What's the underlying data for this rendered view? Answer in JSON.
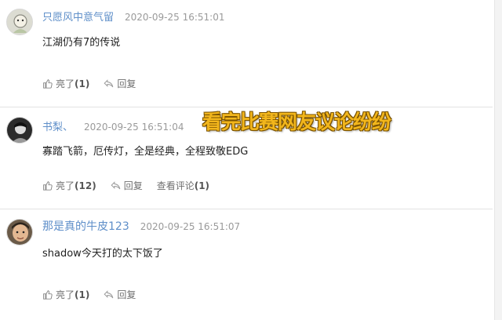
{
  "overlay_caption": "看完比赛网友议论纷纷",
  "comments": [
    {
      "username": "只愿风中意气留",
      "timestamp": "2020-09-25 16:51:01",
      "text": "江湖仍有7的传说",
      "like_label": "亮了",
      "like_count": "(1)",
      "reply_label": "回复"
    },
    {
      "username": "书梨、",
      "timestamp": "2020-09-25 16:51:04",
      "text": "寡踏飞箭，厄传灯，全是经典，全程致敬EDG",
      "like_label": "亮了",
      "like_count": "(12)",
      "reply_label": "回复",
      "view_replies_label": "查看评论",
      "view_replies_count": "(1)"
    },
    {
      "username": "那是真的牛皮123",
      "timestamp": "2020-09-25 16:51:07",
      "text": "shadow今天打的太下饭了",
      "like_label": "亮了",
      "like_count": "(1)",
      "reply_label": "回复"
    }
  ]
}
